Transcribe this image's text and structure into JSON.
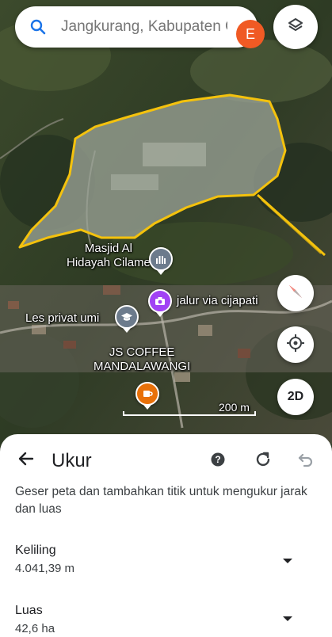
{
  "search": {
    "placeholder": "Jangkurang, Kabupaten Garut"
  },
  "account": {
    "initial": "E",
    "color": "#f05a24"
  },
  "map": {
    "places": [
      {
        "name": "Masjid Al\nHidayah Cilame",
        "icon": "mosque-icon",
        "color": "#6c7b8c"
      },
      {
        "name": "jalur via cijapati",
        "icon": "camera-icon",
        "color": "#a142f4"
      },
      {
        "name": "Les privat umi",
        "icon": "school-icon",
        "color": "#6c7b8c"
      },
      {
        "name": "JS COFFEE\nMANDALAWANGI",
        "icon": "coffee-icon",
        "color": "#e8710a"
      }
    ],
    "scale_label": "200 m",
    "view_mode_label": "2D",
    "polygon_color": "#f4c20d"
  },
  "sheet": {
    "title": "Ukur",
    "description": "Geser peta dan tambahkan titik untuk mengukur jarak dan luas",
    "measurements": [
      {
        "label": "Keliling",
        "value": "4.041,39 m"
      },
      {
        "label": "Luas",
        "value": "42,6 ha"
      }
    ]
  }
}
